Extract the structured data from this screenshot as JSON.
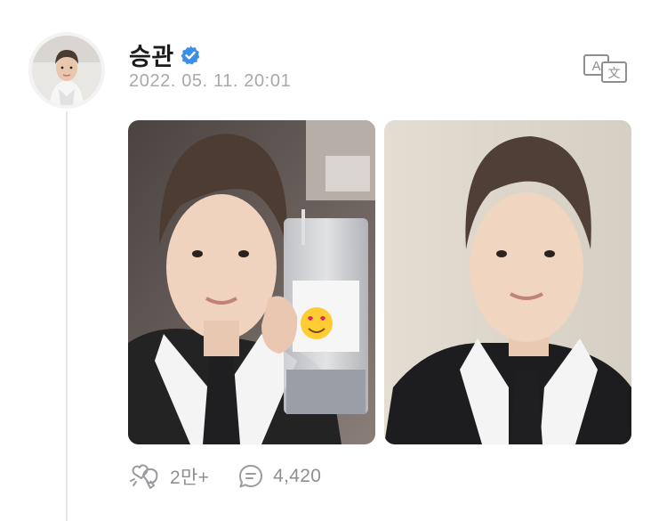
{
  "post": {
    "author_name": "승관",
    "timestamp": "2022. 05. 11. 20:01",
    "translate_icon": "translate-icon",
    "verified_icon": "verified-badge-icon",
    "accent_color": "#3a8fe8",
    "photos": [
      {
        "description_icon": "photo-selfie-with-drink"
      },
      {
        "description_icon": "photo-selfie"
      }
    ],
    "actions": {
      "likes": {
        "icon": "heart-reaction-icon",
        "count": "2만+"
      },
      "comments": {
        "icon": "comment-icon",
        "count": "4,420"
      }
    }
  }
}
